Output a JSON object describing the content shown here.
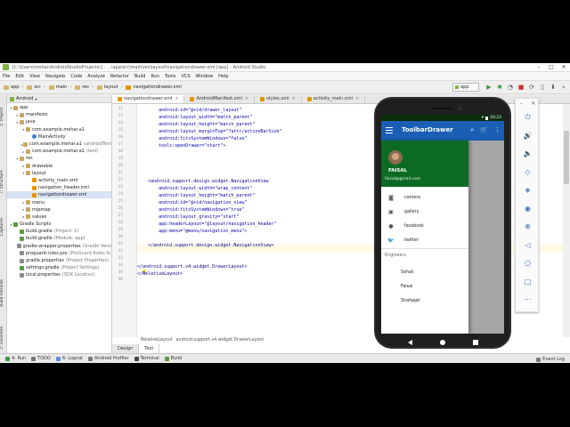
{
  "window": {
    "title": "[C:\\Users\\mehar\\AndroidStudioProjects\\] - ...\\app\\src\\main\\res\\layout\\navigationdrawer.xml [app] - Android Studio"
  },
  "menu": [
    "File",
    "Edit",
    "View",
    "Navigate",
    "Code",
    "Analyze",
    "Refactor",
    "Build",
    "Run",
    "Tools",
    "VCS",
    "Window",
    "Help"
  ],
  "breadcrumbs": [
    "app",
    "src",
    "main",
    "res",
    "layout",
    "navigationdrawer.xml"
  ],
  "run_config": "app",
  "project_panel": {
    "header": "Android",
    "tree": [
      {
        "label": "app",
        "icon": "folder",
        "indent": 0,
        "arrow": "▾"
      },
      {
        "label": "manifests",
        "icon": "folder",
        "indent": 1,
        "arrow": "▸"
      },
      {
        "label": "java",
        "icon": "folder",
        "indent": 1,
        "arrow": "▾"
      },
      {
        "label": "com.example.mehar.a1",
        "icon": "folder",
        "indent": 2,
        "arrow": "▾"
      },
      {
        "label": "MainActivity",
        "icon": "java",
        "indent": 3,
        "arrow": ""
      },
      {
        "label": "com.example.mehar.a1",
        "hint": "(androidTest)",
        "icon": "folder",
        "indent": 2,
        "arrow": "▸"
      },
      {
        "label": "com.example.mehar.a1",
        "hint": "(test)",
        "icon": "folder",
        "indent": 2,
        "arrow": "▸"
      },
      {
        "label": "res",
        "icon": "folder",
        "indent": 1,
        "arrow": "▾"
      },
      {
        "label": "drawable",
        "icon": "folder",
        "indent": 2,
        "arrow": "▸"
      },
      {
        "label": "layout",
        "icon": "folder",
        "indent": 2,
        "arrow": "▾"
      },
      {
        "label": "activity_main.xml",
        "icon": "xml",
        "indent": 3,
        "arrow": ""
      },
      {
        "label": "navigation_header.xml",
        "icon": "xml",
        "indent": 3,
        "arrow": ""
      },
      {
        "label": "navigationdrawer.xml",
        "icon": "xml",
        "indent": 3,
        "arrow": "",
        "selected": true
      },
      {
        "label": "menu",
        "icon": "folder",
        "indent": 2,
        "arrow": "▸"
      },
      {
        "label": "mipmap",
        "icon": "folder",
        "indent": 2,
        "arrow": "▸"
      },
      {
        "label": "values",
        "icon": "folder",
        "indent": 2,
        "arrow": "▸"
      },
      {
        "label": "Gradle Scripts",
        "icon": "gradle",
        "indent": 0,
        "arrow": "▾"
      },
      {
        "label": "build.gradle",
        "hint": "(Project: 1)",
        "icon": "gradle",
        "indent": 1,
        "arrow": ""
      },
      {
        "label": "build.gradle",
        "hint": "(Module: app)",
        "icon": "gradle",
        "indent": 1,
        "arrow": ""
      },
      {
        "label": "gradle-wrapper.properties",
        "hint": "(Gradle Versi",
        "icon": "prop",
        "indent": 1,
        "arrow": ""
      },
      {
        "label": "proguard-rules.pro",
        "hint": "(ProGuard Rules fo",
        "icon": "prop",
        "indent": 1,
        "arrow": ""
      },
      {
        "label": "gradle.properties",
        "hint": "(Project Properties)",
        "icon": "prop",
        "indent": 1,
        "arrow": ""
      },
      {
        "label": "settings.gradle",
        "hint": "(Project Settings)",
        "icon": "gradle",
        "indent": 1,
        "arrow": ""
      },
      {
        "label": "local.properties",
        "hint": "(SDK Location)",
        "icon": "prop",
        "indent": 1,
        "arrow": ""
      }
    ]
  },
  "left_tool_tabs": [
    "1: Project",
    "7: Structure",
    "Captures",
    "Build Variants",
    "2: Favorites"
  ],
  "editor_tabs": [
    {
      "label": "navigationdrawer.xml",
      "active": true
    },
    {
      "label": "AndroidManifest.xml",
      "active": false
    },
    {
      "label": "styles.xml",
      "active": false
    },
    {
      "label": "activity_main.xml",
      "active": false
    }
  ],
  "code_lines": [
    {
      "n": "12",
      "text": "        android:id=\"@+id/drawer_layout\""
    },
    {
      "n": "13",
      "text": "        android:layout_width=\"match_parent\""
    },
    {
      "n": "14",
      "text": "        android:layout_height=\"match_parent\""
    },
    {
      "n": "15",
      "text": "        android:layout_marginTop=\"?attr/actionBarSize\""
    },
    {
      "n": "16",
      "text": "        android:fitsSystemWindows=\"false\""
    },
    {
      "n": "17",
      "text": "        tools:openDrawer=\"start\">"
    },
    {
      "n": "18",
      "text": ""
    },
    {
      "n": "19",
      "text": ""
    },
    {
      "n": "20",
      "text": ""
    },
    {
      "n": "21",
      "text": ""
    },
    {
      "n": "22",
      "text": "    <android.support.design.widget.NavigationView"
    },
    {
      "n": "23",
      "text": "        android:layout_width=\"wrap_content\""
    },
    {
      "n": "24",
      "text": "        android:layout_height=\"match_parent\""
    },
    {
      "n": "25",
      "text": "        android:id=\"@+id/navigation_view\""
    },
    {
      "n": "26",
      "text": "        android:fitsSystemWindows=\"true\""
    },
    {
      "n": "27",
      "text": "        android:layout_gravity=\"start\""
    },
    {
      "n": "28",
      "text": "        app:headerLayout=\"@layout/navigation_header\""
    },
    {
      "n": "29",
      "text": "        app:menu=\"@menu/navigation_menu\">"
    },
    {
      "n": "30",
      "text": ""
    },
    {
      "n": "31",
      "text": "    </android.support.design.widget.NavigationView>"
    },
    {
      "n": "32",
      "text": ""
    },
    {
      "n": "33",
      "text": ""
    },
    {
      "n": "34",
      "text": "</android.support.v4.widget.DrawerLayout>"
    },
    {
      "n": "35",
      "text": "</RelativeLayout>"
    },
    {
      "n": "36",
      "text": ""
    }
  ],
  "editor_breadcrumb": [
    "RelativeLayout",
    "android.support.v4.widget.DrawerLayout"
  ],
  "design_tabs": [
    {
      "label": "Design",
      "active": false
    },
    {
      "label": "Text",
      "active": true
    }
  ],
  "status_tools": [
    {
      "label": "4: Run",
      "color": "#3a9a3a"
    },
    {
      "label": "TODO",
      "color": "#777777"
    },
    {
      "label": "6: Logcat",
      "color": "#5a8fd8"
    },
    {
      "label": "Android Profiler",
      "color": "#777777"
    },
    {
      "label": "Terminal",
      "color": "#444444"
    },
    {
      "label": "Build",
      "color": "#5a9b3c"
    }
  ],
  "event_log": "Event Log",
  "phone": {
    "time": "10:23",
    "app_title": "ToolbarDrawer",
    "toolbar_color": "#1a5fb4",
    "header_color": "#0c6b22",
    "user_name": "FAISAL",
    "user_email": "faisal@gmail.com",
    "menu_items": [
      {
        "label": "camera",
        "icon": "camera-icon"
      },
      {
        "label": "gallery",
        "icon": "gallery-icon"
      },
      {
        "label": "facebook",
        "icon": "facebook-icon"
      },
      {
        "label": "twitter",
        "icon": "twitter-icon"
      }
    ],
    "section_title": "Engineers",
    "engineers": [
      "Sohail",
      "Faisal",
      "Shafaqat"
    ]
  },
  "emulator_controls": [
    "power-icon",
    "volume-up-icon",
    "volume-down-icon",
    "rotate-left-icon",
    "rotate-right-icon",
    "camera-icon",
    "zoom-icon",
    "back-icon",
    "home-icon",
    "overview-icon",
    "more-icon"
  ]
}
